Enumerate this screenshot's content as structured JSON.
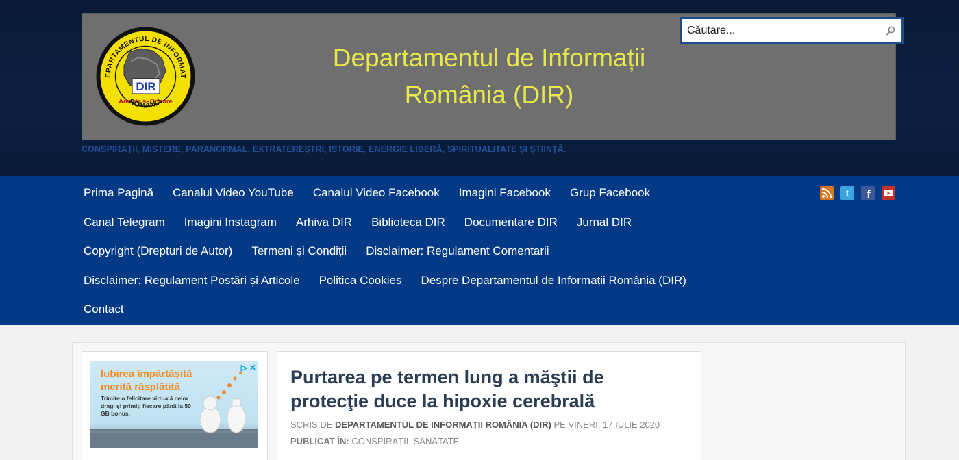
{
  "header": {
    "logo_top_text": "DEPARTAMENTUL DE INFORMATII",
    "logo_badge": "DIR",
    "logo_motto": "Adevăr și Onoare",
    "logo_bottom_text": "ROMÂNIA",
    "title_line1": "Departamentul de Informații",
    "title_line2": "România (DIR)",
    "tagline": "CONSPIRAȚII, MISTERE, PARANORMAL, EXTRATEREȘTRI, ISTORIE, ENERGIE LIBERĂ, SPIRITUALITATE ȘI ȘTIINȚĂ."
  },
  "search": {
    "placeholder": "Căutare...",
    "icon": "search-icon"
  },
  "nav": {
    "rows": [
      [
        "Prima Pagină",
        "Canalul Video YouTube",
        "Canalul Video Facebook",
        "Imagini Facebook",
        "Grup Facebook"
      ],
      [
        "Canal Telegram",
        "Imagini Instagram",
        "Arhiva DIR",
        "Biblioteca DIR",
        "Documentare DIR",
        "Jurnal DIR"
      ],
      [
        "Copyright (Drepturi de Autor)",
        "Termeni și Condiții",
        "Disclaimer: Regulament Comentarii"
      ],
      [
        "Disclaimer: Regulament Postări și Articole",
        "Politica Cookies",
        "Despre Departamentul de Informații România (DIR)"
      ],
      [
        "Contact"
      ]
    ]
  },
  "social": [
    {
      "icon": "rss-icon",
      "color": "#d9771f"
    },
    {
      "icon": "twitter-icon",
      "color": "#3aa5dd"
    },
    {
      "icon": "facebook-icon",
      "color": "#3b5998"
    },
    {
      "icon": "youtube-icon",
      "color": "#c4302b"
    }
  ],
  "ad": {
    "headline": "Iubirea împărtășită merită răsplătită",
    "subtext": "Trimite o felicitare virtuală celor dragi și primiți fiecare până la 50 GB bonus.",
    "adchoices": "▷",
    "close": "✕"
  },
  "article": {
    "title": "Purtarea pe termen lung a măştii de protecţie duce la hipoxie cerebrală",
    "written_by_label": "SCRIS DE",
    "author": "DEPARTAMENTUL DE INFORMAȚII ROMÂNIA (DIR)",
    "on_label": "PE",
    "date": "VINERI, 17 IULIE 2020",
    "published_label": "PUBLICAT ÎN:",
    "categories": "CONSPIRAȚII, SĂNĂTATE"
  },
  "colors": {
    "header_bg": "#0b1f40",
    "banner_bg": "#6f6f6f",
    "title_color": "#e8e84a",
    "nav_bg": "#043a85",
    "tagline_color": "#23509a",
    "article_title_color": "#2a3d52"
  }
}
